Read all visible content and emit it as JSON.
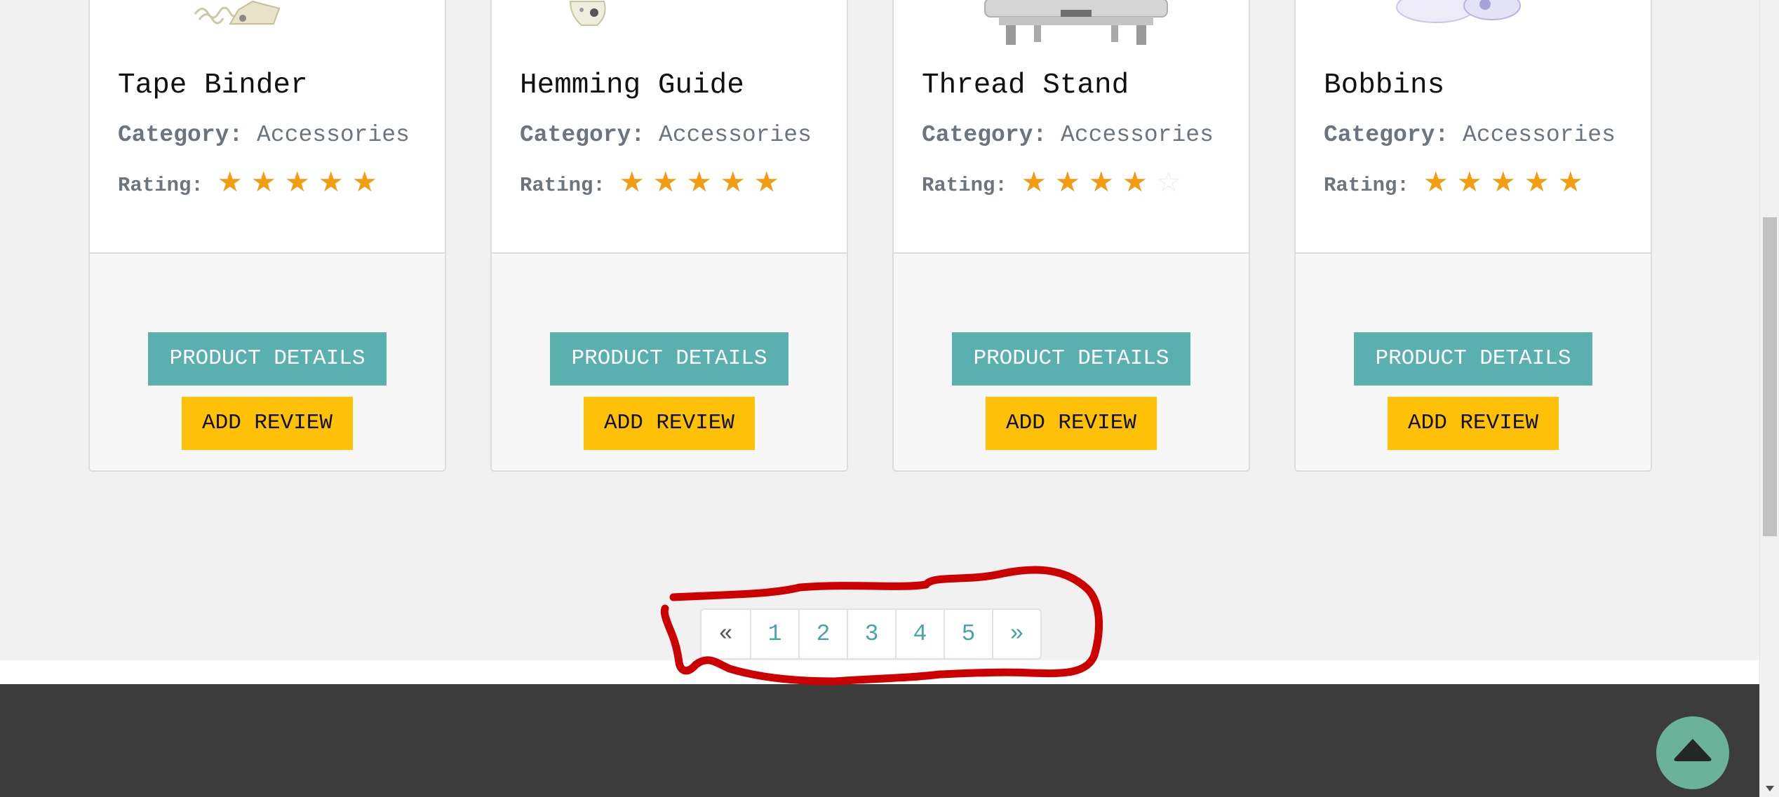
{
  "colors": {
    "page_background": "#f1f1f1",
    "details_button": "#5aafaf",
    "review_button": "#ffc107",
    "star_filled": "#f39c12",
    "star_empty": "#e8f0f7",
    "pagination_link": "#4aa3a8",
    "footer": "#3c3c3c",
    "scroll_top_button": "#6ab39a",
    "annotation_ink": "#cc0000"
  },
  "products": [
    {
      "name": "Tape Binder",
      "category_label": "Category:",
      "category": "Accessories",
      "rating_label": "Rating:",
      "rating": 5,
      "rating_max": 5,
      "details_label": "PRODUCT DETAILS",
      "review_label": "ADD REVIEW"
    },
    {
      "name": "Hemming Guide",
      "category_label": "Category:",
      "category": "Accessories",
      "rating_label": "Rating:",
      "rating": 5,
      "rating_max": 5,
      "details_label": "PRODUCT DETAILS",
      "review_label": "ADD REVIEW"
    },
    {
      "name": "Thread Stand",
      "category_label": "Category:",
      "category": "Accessories",
      "rating_label": "Rating:",
      "rating": 4,
      "rating_max": 5,
      "details_label": "PRODUCT DETAILS",
      "review_label": "ADD REVIEW"
    },
    {
      "name": "Bobbins",
      "category_label": "Category:",
      "category": "Accessories",
      "rating_label": "Rating:",
      "rating": 5,
      "rating_max": 5,
      "details_label": "PRODUCT DETAILS",
      "review_label": "ADD REVIEW"
    }
  ],
  "pagination": {
    "prev": "«",
    "pages": [
      "1",
      "2",
      "3",
      "4",
      "5"
    ],
    "next": "»"
  },
  "icons": {
    "star": "★",
    "star_empty": "☆",
    "scroll_top": "chevron-up-icon"
  }
}
